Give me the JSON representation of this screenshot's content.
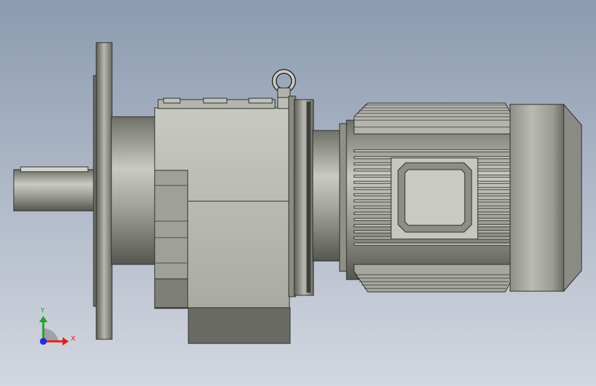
{
  "viewport": {
    "model": "gear-motor-assembly",
    "background_top": "#8c9bb0",
    "background_bottom": "#d3d7df"
  },
  "triad": {
    "x_label": "X",
    "y_label": "Y",
    "x_color": "#e0201b",
    "y_color": "#1fa12a",
    "z_color": "#1d2fd6"
  }
}
